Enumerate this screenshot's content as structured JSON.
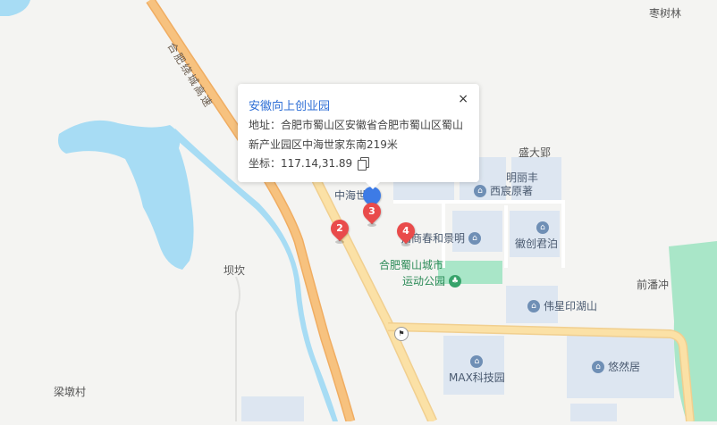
{
  "map": {
    "expressway_label": "合肥绕城高速",
    "place_labels": [
      "枣树林",
      "盛大郢",
      "坝坎",
      "前潘冲",
      "梁墩村"
    ],
    "pois": {
      "zhonghai": "中海世家",
      "zhaoshang": "招商春和景明",
      "huichuang": "徽创君泊",
      "mingli": "明丽丰",
      "xichen": "西宸原著",
      "sports_park_line1": "合肥蜀山城市",
      "sports_park_line2": "运动公园",
      "weixing": "伟星印湖山",
      "max": "MAX科技园",
      "youran": "悠然居"
    },
    "markers": [
      "2",
      "3",
      "4"
    ],
    "colors": {
      "water": "#a7dcf4",
      "park": "#a9e6c8",
      "expressway": "#f7c27f",
      "main_road": "#fbe1a6",
      "building": "#dde6f1",
      "marker_red": "#e94b4b",
      "marker_blue": "#3d7be6",
      "link": "#2f6fd6"
    }
  },
  "popup": {
    "title": "安徽向上创业园",
    "address": "地址：合肥市蜀山区安徽省合肥市蜀山区蜀山新产业园区中海世家东南219米",
    "coord_label": "坐标：",
    "coord_value": "117.14,31.89",
    "close": "×"
  }
}
